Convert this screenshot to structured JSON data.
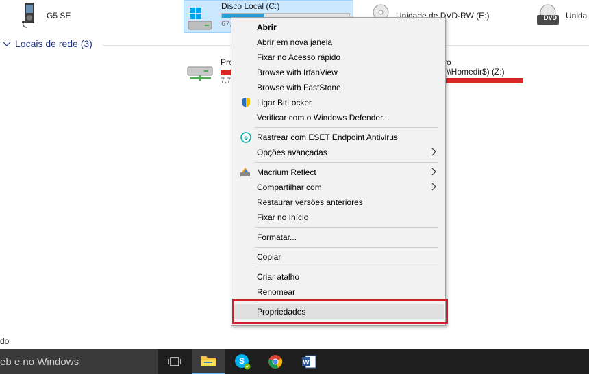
{
  "devices": {
    "g5": {
      "name": "G5 SE"
    },
    "disk_c": {
      "name": "Disco Local (C:)",
      "sub": "67,",
      "usage": 0.33
    },
    "dvd_rw": {
      "name": "Unidade de DVD-RW (E:)"
    },
    "dvd2": {
      "name": "Unida",
      "badge": "DVD"
    }
  },
  "network_section": {
    "label": "Locais de rede (3)"
  },
  "network": {
    "left": {
      "name": "Pro",
      "sub": "7,7"
    },
    "right": {
      "name": "ro",
      "name2": "(\\\\Homedir$) (Z:)"
    }
  },
  "status_bar": {
    "text": "do"
  },
  "context_menu": {
    "items": [
      {
        "label": "Abrir",
        "bold": true
      },
      {
        "label": "Abrir em nova janela"
      },
      {
        "label": "Fixar no Acesso rápido"
      },
      {
        "label": "Browse with IrfanView"
      },
      {
        "label": "Browse with FastStone"
      },
      {
        "label": "Ligar BitLocker",
        "icon": "shield-icon"
      },
      {
        "label": "Verificar com o Windows Defender..."
      },
      {
        "label": "Rastrear com ESET Endpoint Antivirus",
        "icon": "eset-icon"
      },
      {
        "label": "Opções avançadas",
        "submenu": true
      },
      {
        "label": "Macrium Reflect",
        "icon": "macrium-icon",
        "submenu": true
      },
      {
        "label": "Compartilhar com",
        "submenu": true
      },
      {
        "label": "Restaurar versões anteriores"
      },
      {
        "label": "Fixar no Início"
      },
      {
        "label": "Formatar..."
      },
      {
        "label": "Copiar"
      },
      {
        "label": "Criar atalho"
      },
      {
        "label": "Renomear"
      },
      {
        "label": "Propriedades",
        "highlighted": true
      }
    ]
  },
  "taskbar": {
    "search_text": "eb e no Windows",
    "apps": [
      "task-view",
      "file-explorer",
      "skype",
      "chrome",
      "word"
    ]
  },
  "colors": {
    "selection": "#cce8ff",
    "highlight_border": "#d0202e",
    "drive_bar_blue": "#26a0da",
    "drive_bar_red": "#da2626",
    "taskbar": "#1e1e1e"
  }
}
